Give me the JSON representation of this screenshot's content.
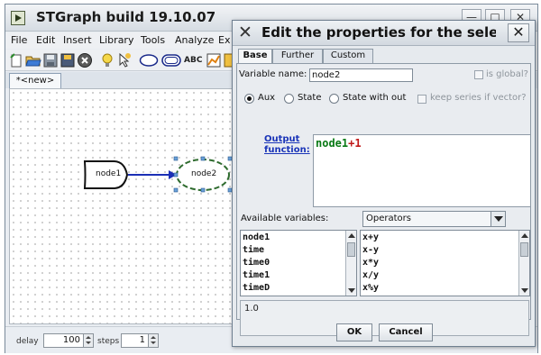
{
  "main_window": {
    "title": "STGraph build 19.10.07",
    "controls": {
      "minimize": "—",
      "maximize": "□",
      "close": "✕"
    },
    "menu": [
      "File",
      "Edit",
      "Insert",
      "Library",
      "Tools",
      "Analyze",
      "Ex"
    ],
    "toolbar": {
      "text_tool_label": "ABC"
    },
    "document_tab": "*<new>",
    "nodes": [
      {
        "label": "node1"
      },
      {
        "label": "node2"
      }
    ],
    "status": {
      "delay_label": "delay",
      "delay_value": "100",
      "steps_label": "steps",
      "steps_value": "1"
    }
  },
  "dialog": {
    "title": "Edit the properties for the selected",
    "close_label": "✕",
    "tabs": [
      "Base",
      "Further",
      "Custom"
    ],
    "active_tab": "Base",
    "variable_name_label": "Variable name:",
    "variable_name_value": "node2",
    "is_global_label": "is global?",
    "radios": [
      {
        "label": "Aux",
        "checked": true
      },
      {
        "label": "State",
        "checked": false
      },
      {
        "label": "State with out",
        "checked": false
      }
    ],
    "keep_series_label": "keep series if vector?",
    "output_function_label": "Output function:",
    "output_function": {
      "var": "node1",
      "op": "+",
      "num": "1"
    },
    "available_variables_label": "Available variables:",
    "operators_select": "Operators",
    "variables": [
      "node1",
      "time",
      "time0",
      "time1",
      "timeD"
    ],
    "operators": [
      "x+y",
      "x-y",
      "x*y",
      "x/y",
      "x%y"
    ],
    "help_text": "1.0",
    "ok_label": "OK",
    "cancel_label": "Cancel"
  },
  "colors": {
    "edge_blue": "#1b2fb5",
    "selection_green": "#2e6b2e",
    "link_blue": "#1a34b8",
    "formula_green": "#0a7a16",
    "formula_red": "#c01818"
  }
}
